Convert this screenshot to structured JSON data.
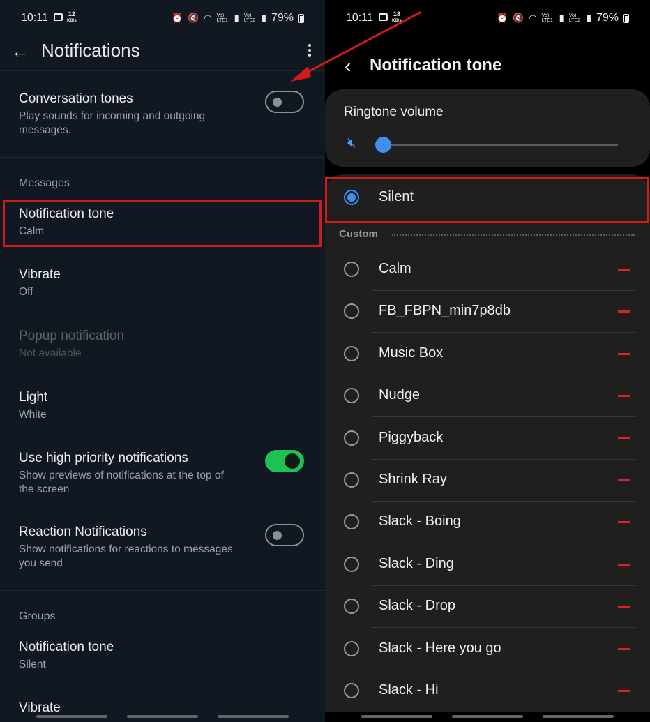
{
  "left": {
    "status": {
      "time": "10:11",
      "net_speed": "12",
      "net_unit": "KB/s",
      "signal1": "Vo)\nLTE1",
      "signal2": "Vo)\nLTE2",
      "battery": "79%"
    },
    "title": "Notifications",
    "conversation": {
      "title": "Conversation tones",
      "desc": "Play sounds for incoming and outgoing messages.",
      "enabled": false
    },
    "messages_header": "Messages",
    "notification_tone": {
      "title": "Notification tone",
      "value": "Calm"
    },
    "vibrate": {
      "title": "Vibrate",
      "value": "Off"
    },
    "popup": {
      "title": "Popup notification",
      "value": "Not available"
    },
    "light": {
      "title": "Light",
      "value": "White"
    },
    "high_priority": {
      "title": "Use high priority notifications",
      "desc": "Show previews of notifications at the top of the screen",
      "enabled": true
    },
    "reaction": {
      "title": "Reaction Notifications",
      "desc": "Show notifications for reactions to messages you send",
      "enabled": false
    },
    "groups_header": "Groups",
    "group_tone": {
      "title": "Notification tone",
      "value": "Silent"
    },
    "group_vibrate": {
      "title": "Vibrate"
    }
  },
  "right": {
    "status": {
      "time": "10:11",
      "net_speed": "18",
      "net_unit": "KB/s",
      "signal1": "Vo)\nLTE1",
      "signal2": "Vo)\nLTE2",
      "battery": "79%"
    },
    "title": "Notification tone",
    "volume": {
      "label": "Ringtone volume",
      "level": 0
    },
    "silent": {
      "label": "Silent",
      "selected": true
    },
    "custom_header": "Custom",
    "tones": [
      "Calm",
      "FB_FBPN_min7p8db",
      "Music Box",
      "Nudge",
      "Piggyback",
      "Shrink Ray",
      "Slack - Boing",
      "Slack - Ding",
      "Slack - Drop",
      "Slack - Here you go",
      "Slack - Hi"
    ]
  },
  "colors": {
    "toggle_on": "#1ec253",
    "accent_blue": "#3e8ff0",
    "highlight_red": "#d11a1a",
    "remove_red": "#d4262a"
  },
  "icons": [
    "back-arrow-icon",
    "more-vert-icon",
    "chevron-left-icon",
    "volume-mute-icon",
    "alarm-icon",
    "mute-icon",
    "wifi-icon",
    "signal-icon",
    "battery-icon",
    "image-icon"
  ]
}
